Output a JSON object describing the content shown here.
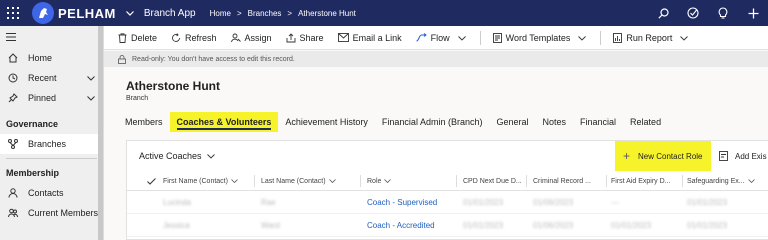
{
  "topbar": {
    "brand": "PELHAM",
    "app_name": "Branch App",
    "breadcrumb": [
      "Home",
      "Branches",
      "Atherstone Hunt"
    ],
    "icons": [
      "search-icon",
      "task-icon",
      "lightbulb-icon",
      "plus-icon"
    ]
  },
  "sidebar": {
    "items": [
      {
        "label": "Home",
        "icon": "home-icon"
      },
      {
        "label": "Recent",
        "icon": "clock-icon"
      },
      {
        "label": "Pinned",
        "icon": "pin-icon"
      }
    ],
    "sections": [
      {
        "title": "Governance",
        "items": [
          {
            "label": "Branches",
            "icon": "branches-icon",
            "active": true
          }
        ]
      },
      {
        "title": "Membership",
        "items": [
          {
            "label": "Contacts",
            "icon": "person-icon"
          },
          {
            "label": "Current Members",
            "icon": "people-icon"
          }
        ]
      }
    ]
  },
  "commands": {
    "delete": "Delete",
    "refresh": "Refresh",
    "assign": "Assign",
    "share": "Share",
    "email_link": "Email a Link",
    "flow": "Flow",
    "word_templates": "Word Templates",
    "run_report": "Run Report"
  },
  "notice": "Read-only: You don't have access to edit this record.",
  "record": {
    "title": "Atherstone Hunt",
    "type": "Branch"
  },
  "tabs": [
    {
      "label": "Members",
      "active": false
    },
    {
      "label": "Coaches & Volunteers",
      "active": true
    },
    {
      "label": "Achievement History",
      "active": false
    },
    {
      "label": "Financial Admin (Branch)",
      "active": false
    },
    {
      "label": "General",
      "active": false
    },
    {
      "label": "Notes",
      "active": false
    },
    {
      "label": "Financial",
      "active": false
    },
    {
      "label": "Related",
      "active": false
    }
  ],
  "subgrid": {
    "view_name": "Active Coaches",
    "new_button": "New Contact Role",
    "add_existing": "Add Exis",
    "columns": [
      "First Name (Contact)",
      "Last Name (Contact)",
      "Role",
      "CPD Next Due D...",
      "Criminal Record ...",
      "First Aid Expiry D...",
      "Safeguarding Ex..."
    ],
    "rows": [
      {
        "first": "Lucinda",
        "last": "Rae",
        "role": "Coach - Supervised",
        "cpd": "01/01/2023",
        "crb": "01/06/2023",
        "first_aid": "---",
        "safeguarding": "01/01/2023"
      },
      {
        "first": "Jessica",
        "last": "Ward",
        "role": "Coach - Accredited",
        "cpd": "01/01/2023",
        "crb": "01/06/2023",
        "first_aid": "01/01/2023",
        "safeguarding": "01/01/2023"
      }
    ]
  }
}
